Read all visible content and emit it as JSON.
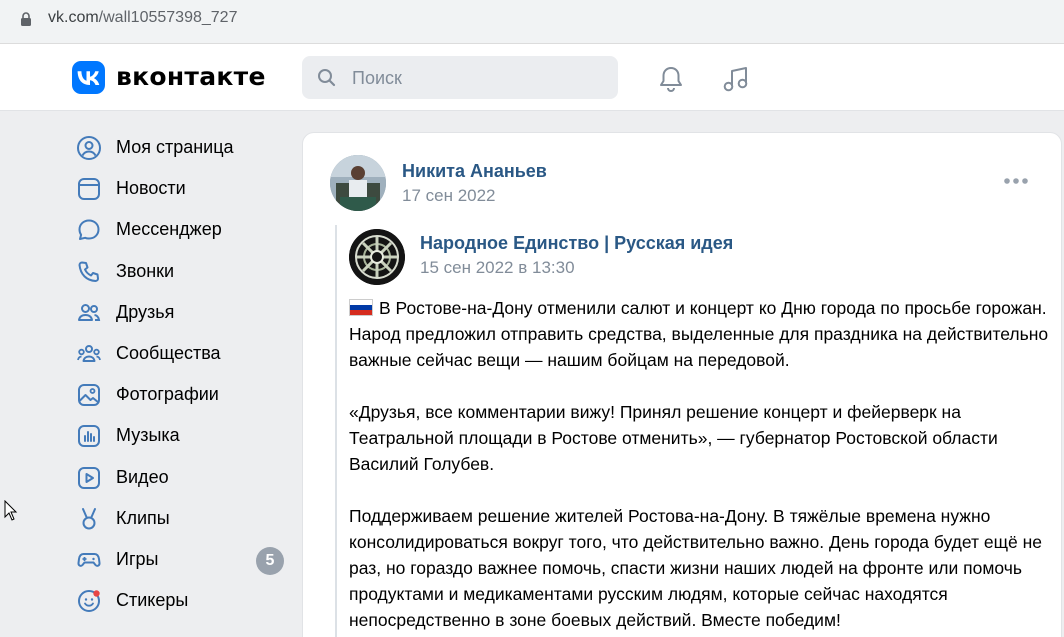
{
  "browser": {
    "url_domain": "vk.com",
    "url_path": "/wall10557398_727"
  },
  "header": {
    "logo_text": "вконтакте",
    "search_placeholder": "Поиск"
  },
  "sidebar": {
    "items": [
      {
        "label": "Моя страница",
        "icon": "user-circle-icon"
      },
      {
        "label": "Новости",
        "icon": "news-icon"
      },
      {
        "label": "Мессенджер",
        "icon": "chat-bubble-icon"
      },
      {
        "label": "Звонки",
        "icon": "phone-icon"
      },
      {
        "label": "Друзья",
        "icon": "friends-icon"
      },
      {
        "label": "Сообщества",
        "icon": "communities-icon"
      },
      {
        "label": "Фотографии",
        "icon": "photo-icon"
      },
      {
        "label": "Музыка",
        "icon": "music-icon"
      },
      {
        "label": "Видео",
        "icon": "video-icon"
      },
      {
        "label": "Клипы",
        "icon": "clips-icon"
      },
      {
        "label": "Игры",
        "icon": "gamepad-icon",
        "badge": "5"
      },
      {
        "label": "Стикеры",
        "icon": "sticker-icon"
      }
    ]
  },
  "post": {
    "author": "Никита Ананьев",
    "date": "17 сен 2022",
    "repost": {
      "group": "Народное Единство | Русская идея",
      "date": "15 сен 2022 в 13:30"
    },
    "paragraphs": [
      "В Ростове-на-Дону отменили салют и концерт ко Дню города по просьбе горожан. Народ предложил отправить средства, выделенные для праздника на действительно важные сейчас вещи — нашим бойцам на передовой.",
      "«Друзья, все комментарии вижу! Принял решение концерт и фейерверк на Театральной площади в Ростове отменить», — губернатор Ростовской области Василий Голубев.",
      "Поддерживаем решение жителей Ростова-на-Дону. В тяжёлые времена нужно консолидироваться вокруг того, что действительно важно. День города будет ещё не раз, но гораздо важнее помочь, спасти жизни наших людей на фронте или помочь продуктами и медикаментами русским людям, которые сейчас находятся непосредственно в зоне боевых действий. Вместе победим!"
    ]
  },
  "colors": {
    "accent": "#0077ff",
    "link": "#2a5885",
    "muted": "#818c99",
    "page_bg": "#edeef0"
  }
}
